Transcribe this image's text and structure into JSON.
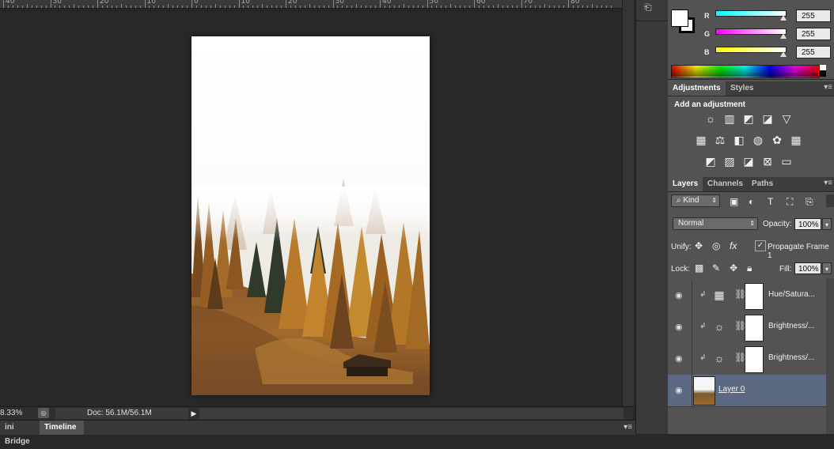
{
  "ruler": {
    "labels": [
      "40",
      "30",
      "20",
      "10",
      "0",
      "10",
      "20",
      "30",
      "40",
      "50",
      "60",
      "70",
      "80"
    ]
  },
  "statusbar": {
    "zoom": "8.33%",
    "docinfo": "Doc: 56.1M/56.1M"
  },
  "bottom_tabs": [
    "ini Bridge",
    "Timeline"
  ],
  "color": {
    "foreground": "#ffffff",
    "background": "#ffffff",
    "channels": [
      {
        "label": "R",
        "value": "255",
        "gradient": "#00ffff"
      },
      {
        "label": "G",
        "value": "255",
        "gradient": "#ff00ff"
      },
      {
        "label": "B",
        "value": "255",
        "gradient": "#ffff00"
      }
    ]
  },
  "adjustments": {
    "tabs": [
      "Adjustments",
      "Styles"
    ],
    "title": "Add an adjustment",
    "icons": [
      "brightness-contrast-icon",
      "levels-icon",
      "curves-icon",
      "exposure-icon",
      "vibrance-icon",
      "hue-saturation-icon",
      "color-balance-icon",
      "black-white-icon",
      "photo-filter-icon",
      "channel-mixer-icon",
      "color-lookup-icon",
      "invert-icon",
      "posterize-icon",
      "threshold-icon",
      "selective-color-icon",
      "gradient-map-icon"
    ]
  },
  "layers": {
    "tabs": [
      "Layers",
      "Channels",
      "Paths"
    ],
    "filter_kind": "Kind",
    "blend_mode": "Normal",
    "opacity_label": "Opacity:",
    "opacity_value": "100%",
    "unify_label": "Unify:",
    "propagate_label": "Propagate Frame 1",
    "lock_label": "Lock:",
    "fill_label": "Fill:",
    "fill_value": "100%",
    "items": [
      {
        "name": "Hue/Satura...",
        "type": "hue-saturation",
        "selected": false
      },
      {
        "name": "Brightness/...",
        "type": "brightness-contrast",
        "selected": false
      },
      {
        "name": "Brightness/...",
        "type": "brightness-contrast",
        "selected": false
      },
      {
        "name": "Layer 0",
        "type": "pixel",
        "selected": true
      }
    ]
  },
  "colors": {
    "canvas": "#282828",
    "panel": "#535353",
    "selected_layer": "#5b6a82"
  }
}
